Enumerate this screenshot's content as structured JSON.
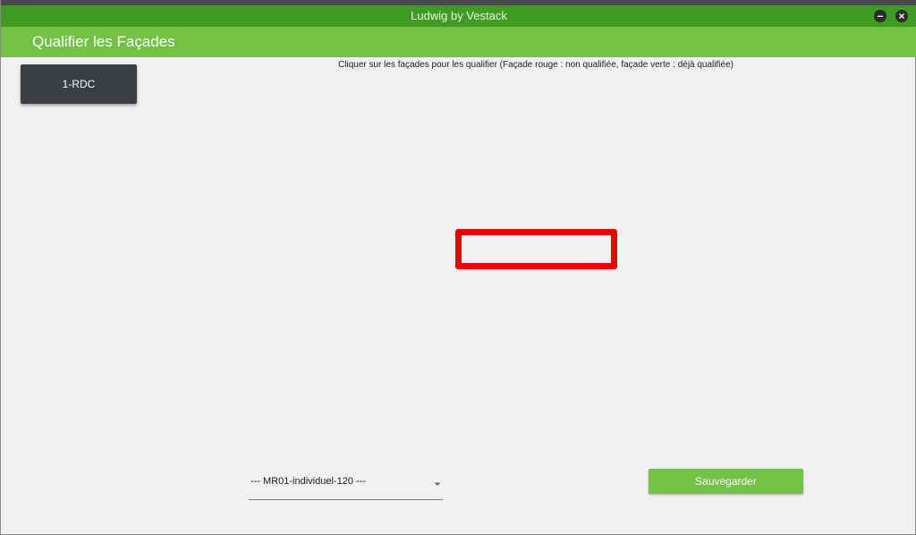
{
  "window": {
    "title": "Ludwig by Vestack",
    "controls": [
      "minimize-icon",
      "close-icon"
    ]
  },
  "appbar": {
    "title": "Qualifier les Façades"
  },
  "floors": [
    {
      "label": "1-RDC"
    }
  ],
  "instruction": "Cliquer sur les façades pour les qualifier (Façade rouge : non qualifiée, façade verte : déjà qualifiée)",
  "facade": {
    "status": "non qualifiée",
    "color": "#ee0000"
  },
  "model_select": {
    "value": "--- MR01-individuel-120 ---"
  },
  "actions": {
    "save_label": "Sauvegarder"
  },
  "colors": {
    "titlebar": "#3f9c23",
    "accent": "#72c246",
    "facade_unqualified": "#ee0000"
  }
}
